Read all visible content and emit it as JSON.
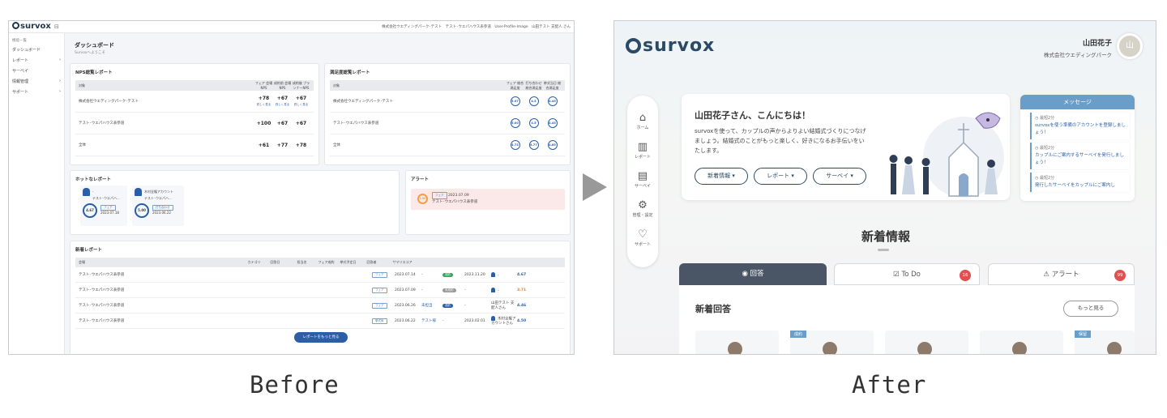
{
  "before": {
    "logo": "survox",
    "topbar_right": "株式会社ウエディングパーク･テスト　テスト･ウエパハウス表参道　User-Profile-Image　山田テスト 支配人 さん",
    "sidebar": {
      "section": "機能一覧",
      "items": [
        {
          "label": "ダッシュボード",
          "caret": ""
        },
        {
          "label": "レポート",
          "caret": "›"
        },
        {
          "label": "サーベイ",
          "caret": ""
        },
        {
          "label": "情報管理",
          "caret": "›"
        },
        {
          "label": "サポート",
          "caret": "›"
        }
      ]
    },
    "page_title": "ダッシュボード",
    "page_subtitle": "Survoxへようこそ",
    "nps_card": {
      "title": "NPS総覧レポート",
      "headers": [
        "対象",
        "フェア 会場NPS",
        "成約前 会場NPS",
        "成約後 プランナーNPS"
      ],
      "rows": [
        {
          "name": "株式会社ウエディングパーク･テスト",
          "v": [
            "+78",
            "+67",
            "+67"
          ]
        },
        {
          "name": "テスト･ウエパハウス表参道",
          "v": [
            "+100",
            "+67",
            "+67"
          ]
        },
        {
          "name": "全体",
          "v": [
            "+61",
            "+77",
            "+78"
          ]
        }
      ],
      "detail": "詳しく見る"
    },
    "sat_card": {
      "title": "満足度総覧レポート",
      "headers": [
        "対象",
        "フェア 総合満足度",
        "打ち合わせ 総合満足度",
        "挙式当日 総合満足度"
      ],
      "rows": [
        {
          "name": "株式会社ウエディングパーク･テスト",
          "v": [
            "3.97",
            "4.5",
            "4.45"
          ]
        },
        {
          "name": "テスト･ウエパハウス表参道",
          "v": [
            "5.00",
            "4.5",
            "4.45"
          ]
        },
        {
          "name": "全体",
          "v": [
            "4.73",
            "4.77",
            "4.65"
          ]
        }
      ]
    },
    "hot_card": {
      "title": "ホットなレポート",
      "items": [
        {
          "name": "-",
          "venue": "テスト･ウエパハ...",
          "score": "4.67",
          "tag": "フェア",
          "date": "2023.07.18"
        },
        {
          "name": "木村全権アカウント",
          "venue": "テスト･ウエパハ...",
          "score": "5.00",
          "tag": "打ち合わせ",
          "date": "2023.06.22"
        }
      ]
    },
    "alert_card": {
      "title": "アラート",
      "item": {
        "score": "1.00",
        "tag": "フェア",
        "date": "2023.07.09",
        "venue": "テスト･ウエパハウス表参道"
      }
    },
    "new_card": {
      "title": "新着レポート",
      "headers": [
        "会場",
        "カテゴリ",
        "回答日",
        "担当名",
        "フェア成約",
        "挙式予定日",
        "回答者",
        "サマリスコア"
      ],
      "rows": [
        {
          "venue": "テスト･ウエパハウス表参道",
          "cat": "フェア",
          "date": "2023.07.14",
          "staff": "-",
          "fair": "成約",
          "wed": "2023.11.20",
          "resp": "-",
          "score": "4.67"
        },
        {
          "venue": "テスト･ウエパハウス表参道",
          "cat": "フェア",
          "date": "2023.07.09",
          "staff": "-",
          "fair": "未成約",
          "wed": "-",
          "resp": "-",
          "score": "3.71"
        },
        {
          "venue": "テスト･ウエパハウス表参道",
          "cat": "フェア",
          "date": "2023.06.26",
          "staff": "未担当",
          "fair": "成約",
          "wed": "-",
          "resp": "山田テスト 支配人さん",
          "score": "4.46"
        },
        {
          "venue": "テスト･ウエパハウス表参道",
          "cat": "挙式後",
          "date": "2023.06.22",
          "staff": "テスト様",
          "fair": "-",
          "wed": "2023.02.01",
          "resp": "木村全権アカウントさん",
          "score": "4.50"
        }
      ],
      "more_button": "レポートをもっと見る"
    }
  },
  "after": {
    "logo": "survox",
    "user_name": "山田花子",
    "company": "株式会社ウエディングパーク",
    "avatar_text": "山",
    "nav": [
      {
        "icon": "⌂",
        "label": "ホーム"
      },
      {
        "icon": "▥",
        "label": "レポート"
      },
      {
        "icon": "▤",
        "label": "サーベイ"
      },
      {
        "icon": "⚙",
        "label": "管理・設定"
      },
      {
        "icon": "♡",
        "label": "サポート"
      }
    ],
    "hero": {
      "title": "山田花子さん、こんにちは！",
      "text": "survoxを使って、カップルの声からよりよい結婚式づくりにつなげましょう。結婚式のことがもっと楽しく、好きになるお手伝いをいたします。",
      "buttons": [
        "新着情報 ▾",
        "レポート ▾",
        "サーベイ ▾"
      ]
    },
    "messages": {
      "title": "メッセージ",
      "items": [
        {
          "time": "◷ 最短2分",
          "text": "survoxを使う準備のアカウントを登録しましょう！"
        },
        {
          "time": "◷ 最短2分",
          "text": "カップルにご案内するサーベイを発行しましょう！"
        },
        {
          "time": "◷ 最短2分",
          "text": "発行したサーベイをカップルにご案内し"
        }
      ]
    },
    "news_title": "新着情報",
    "tabs": [
      {
        "label": "◉ 回答",
        "badge": ""
      },
      {
        "label": "☑ To Do",
        "badge": "16"
      },
      {
        "label": "⚠ アラート",
        "badge": "99"
      }
    ],
    "panel_title": "新着回答",
    "more_button": "もっと見る",
    "cards": [
      {
        "tag": ""
      },
      {
        "tag": "成約"
      },
      {
        "tag": ""
      },
      {
        "tag": ""
      },
      {
        "tag": "保留"
      }
    ]
  },
  "captions": {
    "before": "Before",
    "after": "After"
  }
}
